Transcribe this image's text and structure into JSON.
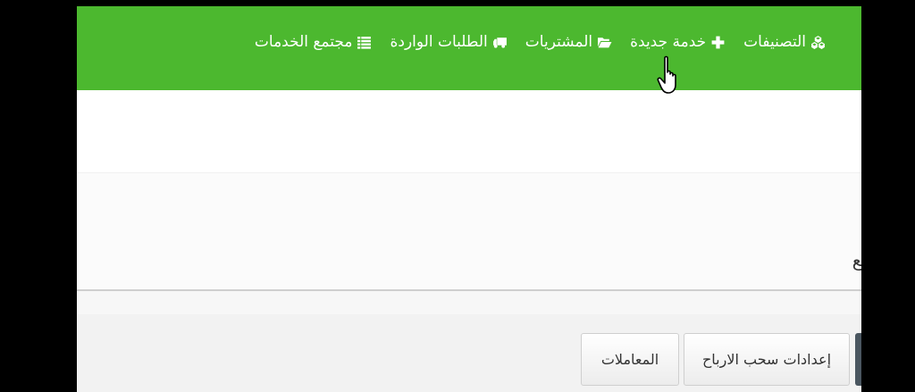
{
  "navbar": {
    "bg": "#4cb82f",
    "items": [
      {
        "label": "التصنيفات",
        "icon": "cubes-icon"
      },
      {
        "label": "خدمة جديدة",
        "icon": "plus-icon"
      },
      {
        "label": "المشتريات",
        "icon": "folder-open-icon"
      },
      {
        "label": "الطلبات الواردة",
        "icon": "truck-icon"
      },
      {
        "label": "مجتمع الخدمات",
        "icon": "list-icon"
      }
    ]
  },
  "content": {
    "partial_word": "تع"
  },
  "tabs": {
    "withdraw_settings": "إعدادات سحب الارباح",
    "transactions": "المعاملات"
  }
}
